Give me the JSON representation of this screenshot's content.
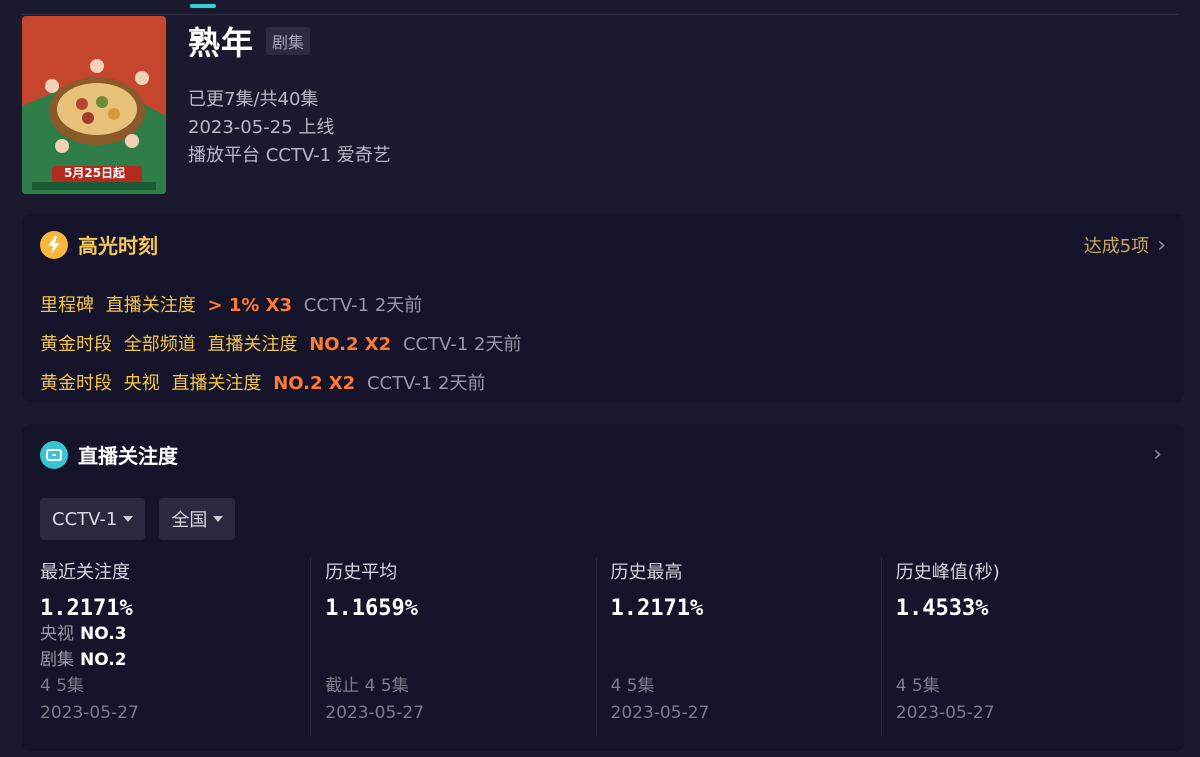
{
  "show": {
    "title": "熟年",
    "type_tag": "剧集",
    "episodes": "已更7集/共40集",
    "release": "2023-05-25 上线",
    "platform": "播放平台 CCTV-1 爱奇艺",
    "poster_text": "5月25日起"
  },
  "highlights": {
    "title": "高光时刻",
    "achieve": "达成5项",
    "rows": [
      {
        "tags": [
          "里程碑",
          "直播关注度"
        ],
        "metric": "> 1% X3",
        "meta": "CCTV-1 2天前"
      },
      {
        "tags": [
          "黄金时段",
          "全部频道",
          "直播关注度"
        ],
        "metric": "NO.2 X2",
        "meta": "CCTV-1 2天前"
      },
      {
        "tags": [
          "黄金时段",
          "央视",
          "直播关注度"
        ],
        "metric": "NO.2 X2",
        "meta": "CCTV-1 2天前"
      }
    ]
  },
  "attention": {
    "title": "直播关注度",
    "filters": [
      "CCTV-1",
      "全国"
    ],
    "stats": [
      {
        "label": "最近关注度",
        "value": "1.2171%",
        "ranks": [
          {
            "k": "央视",
            "v": "NO.3"
          },
          {
            "k": "剧集",
            "v": "NO.2"
          }
        ],
        "sub1": "4 5集",
        "sub2": "2023-05-27"
      },
      {
        "label": "历史平均",
        "value": "1.1659%",
        "sub1": "截止 4 5集",
        "sub2": "2023-05-27"
      },
      {
        "label": "历史最高",
        "value": "1.2171%",
        "sub1": "4 5集",
        "sub2": "2023-05-27"
      },
      {
        "label": "历史峰值(秒)",
        "value": "1.4533%",
        "sub1": "4 5集",
        "sub2": "2023-05-27"
      }
    ]
  },
  "colors": {
    "accent_gold": "#f2c548",
    "accent_orange": "#ff7a33",
    "accent_cyan": "#38c4d2",
    "background": "#1a192d"
  }
}
